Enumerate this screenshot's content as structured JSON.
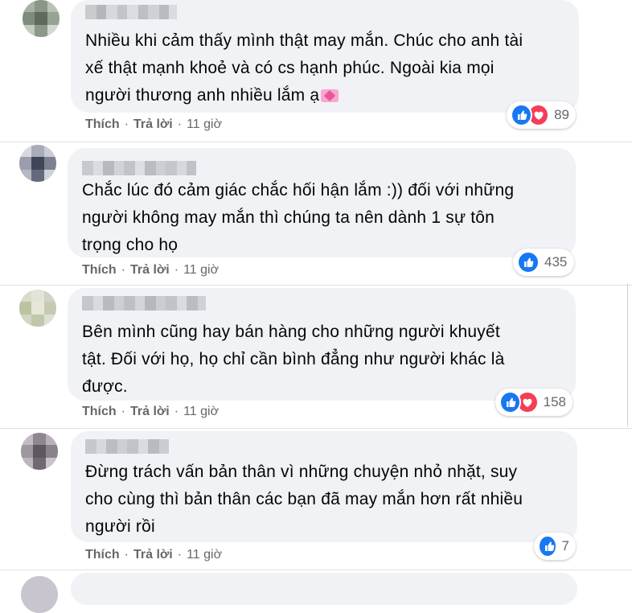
{
  "comments": [
    {
      "text_lines": [
        "Nhiều khi cảm thấy mình thật may mắn. Chúc cho anh tài",
        "xế thật mạnh khoẻ và có cs hạnh phúc. Ngoài kia mọi",
        "người thương anh nhiều lắm ạ"
      ],
      "like_label": "Thích",
      "reply_label": "Trả lời",
      "time": "11 giờ",
      "reaction_count": "89",
      "reactions": [
        "like",
        "love"
      ]
    },
    {
      "text_lines": [
        "Chắc lúc đó cảm giác chắc hối hận lắm :)) đối với những",
        "người không may mắn thì chúng ta nên dành 1 sự tôn",
        "trọng cho họ"
      ],
      "like_label": "Thích",
      "reply_label": "Trả lời",
      "time": "11 giờ",
      "reaction_count": "435",
      "reactions": [
        "like"
      ]
    },
    {
      "text_lines": [
        "Bên mình cũng hay bán hàng cho những người khuyết",
        "tật. Đối với họ, họ chỉ cần bình đẳng như người khác là",
        "được."
      ],
      "like_label": "Thích",
      "reply_label": "Trả lời",
      "time": "11 giờ",
      "reaction_count": "158",
      "reactions": [
        "like",
        "love"
      ]
    },
    {
      "text_lines": [
        "Đừng trách vấn bản thân vì những chuyện nhỏ nhặt, suy",
        "cho cùng thì bản thân các bạn đã may mắn hơn rất nhiều",
        "người rồi"
      ],
      "like_label": "Thích",
      "reply_label": "Trả lời",
      "time": "11 giờ",
      "reaction_count": "7",
      "reactions": [
        "like"
      ]
    }
  ],
  "dot": "·",
  "colors": {
    "bubble": "#f0f2f5",
    "meta": "#65676b",
    "like": "#1877f2",
    "love": "#f33e58"
  }
}
